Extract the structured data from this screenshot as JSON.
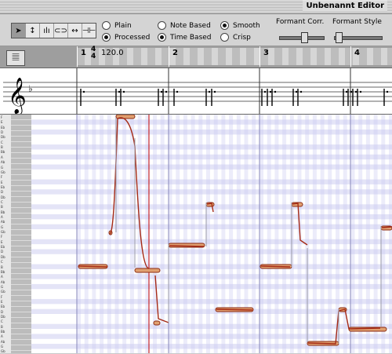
{
  "window": {
    "title": "Unbenannt Editor"
  },
  "toolbar": {
    "tools": [
      {
        "name": "pointer-tool-icon",
        "glyph": "➤",
        "active": true
      },
      {
        "name": "pitch-tool-icon",
        "glyph": "↕",
        "active": false
      },
      {
        "name": "formant-tool-icon",
        "glyph": "ılı",
        "active": false
      },
      {
        "name": "glue-tool-icon",
        "glyph": "⊂⊃",
        "active": false
      },
      {
        "name": "length-tool-icon",
        "glyph": "↔",
        "active": false
      },
      {
        "name": "split-tool-icon",
        "glyph": "⊣⊢",
        "active": false
      }
    ],
    "radios": {
      "plain": {
        "label": "Plain",
        "selected": false
      },
      "processed": {
        "label": "Processed",
        "selected": true
      },
      "note_based": {
        "label": "Note Based",
        "selected": false
      },
      "time_based": {
        "label": "Time Based",
        "selected": true
      },
      "smooth": {
        "label": "Smooth",
        "selected": true
      },
      "crisp": {
        "label": "Crisp",
        "selected": false
      }
    },
    "formant_corr_label": "Formant Corr.",
    "formant_style_label": "Formant Style"
  },
  "ruler": {
    "time_signature": {
      "top": "4",
      "bottom": "4"
    },
    "tempo": "120.0",
    "bars": [
      "1",
      "2",
      "3",
      "4"
    ]
  },
  "staff": {
    "clef": "treble",
    "key": "B-flat"
  },
  "piano_keys": [
    "F",
    "E",
    "Eb",
    "D",
    "Db",
    "C",
    "B",
    "Bb",
    "A",
    "Ab",
    "G",
    "Gb",
    "F",
    "E",
    "Eb",
    "D",
    "Db",
    "C",
    "B",
    "Bb",
    "A",
    "Ab",
    "G",
    "Gb",
    "F",
    "E",
    "Eb",
    "D",
    "Db",
    "C",
    "B",
    "Bb",
    "A",
    "Ab",
    "G",
    "Gb",
    "F",
    "E",
    "Eb",
    "D",
    "Db",
    "C",
    "B",
    "Bb",
    "A",
    "Ab",
    "G",
    "Gb"
  ],
  "playhead": {
    "bar_position": 1.82
  },
  "colors": {
    "note_fill": "#e0a070",
    "note_border": "#8b2a12",
    "pitch_curve": "#a52a16",
    "playhead": "#c00000",
    "grid_blue": "#c8c8f0"
  }
}
